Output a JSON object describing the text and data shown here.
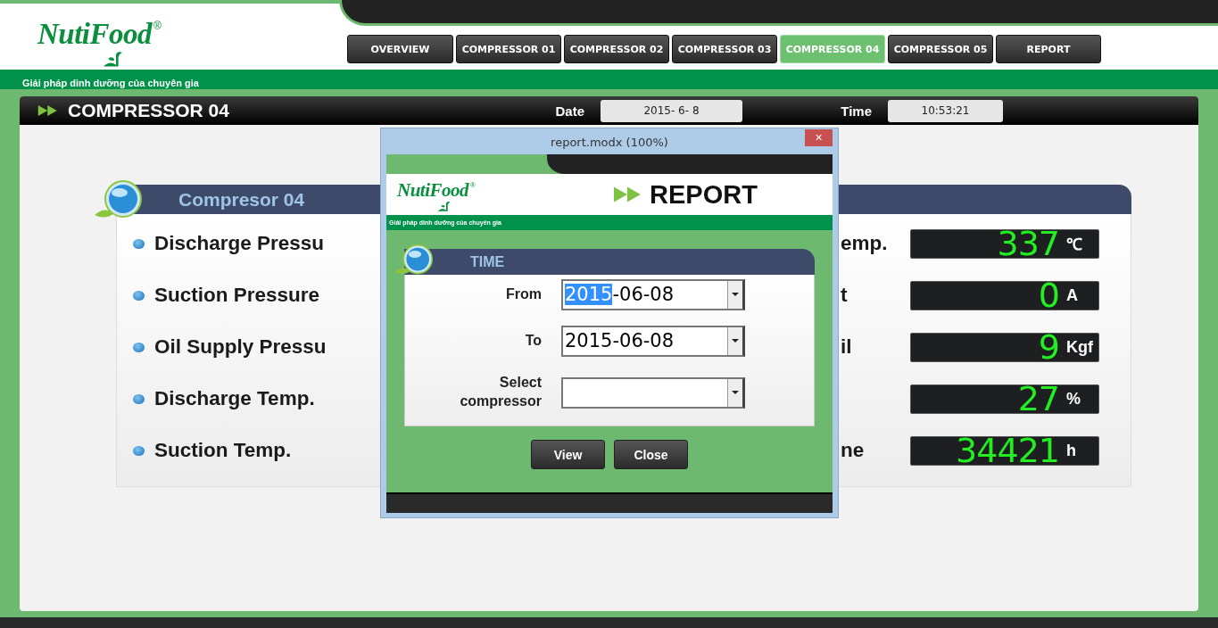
{
  "logo": {
    "brand": "NutiFood",
    "mark": "®",
    "tagline": "Giải pháp dinh dưỡng của chuyên gia"
  },
  "tabs": [
    {
      "label": "OVERVIEW",
      "selected": false
    },
    {
      "label": "COMPRESSOR 01",
      "selected": false
    },
    {
      "label": "COMPRESSOR 02",
      "selected": false
    },
    {
      "label": "COMPRESSOR 03",
      "selected": false
    },
    {
      "label": "COMPRESSOR 04",
      "selected": true
    },
    {
      "label": "COMPRESSOR 05",
      "selected": false
    },
    {
      "label": "REPORT",
      "selected": false
    }
  ],
  "page_title": "COMPRESSOR 04",
  "date": {
    "label": "Date",
    "value": "2015- 6- 8"
  },
  "time": {
    "label": "Time",
    "value": "10:53:21"
  },
  "panel": {
    "title": "Compresor 04",
    "rows": [
      {
        "label": "Discharge Pressu",
        "right_label": "emp.",
        "value": "337",
        "unit": "℃"
      },
      {
        "label": "Suction Pressure",
        "right_label": "t",
        "value": "0",
        "unit": "A"
      },
      {
        "label": "Oil Supply Pressu",
        "right_label": "il",
        "value": "9",
        "unit": "Kgf"
      },
      {
        "label": "Discharge Temp.",
        "value": "27",
        "unit": "%"
      },
      {
        "label": "Suction Temp.",
        "right_label": "ne",
        "value": "34421",
        "unit": "h"
      }
    ]
  },
  "dialog": {
    "title": "report.modx (100%)",
    "close": "×",
    "brand": "NutiFood",
    "mark": "®",
    "tagline": "Giải pháp dinh dưỡng của chuyên gia",
    "heading": "REPORT",
    "section": "TIME",
    "fields": [
      {
        "label": "From",
        "value_parts": [
          {
            "text": "2015",
            "selected": true
          },
          {
            "text": "-06-08",
            "selected": false
          }
        ]
      },
      {
        "label": "To",
        "value_parts": [
          {
            "text": "2015-06-08",
            "selected": false
          }
        ]
      },
      {
        "label": "Select compressor"
      }
    ],
    "buttons": [
      "View",
      "Close"
    ]
  }
}
